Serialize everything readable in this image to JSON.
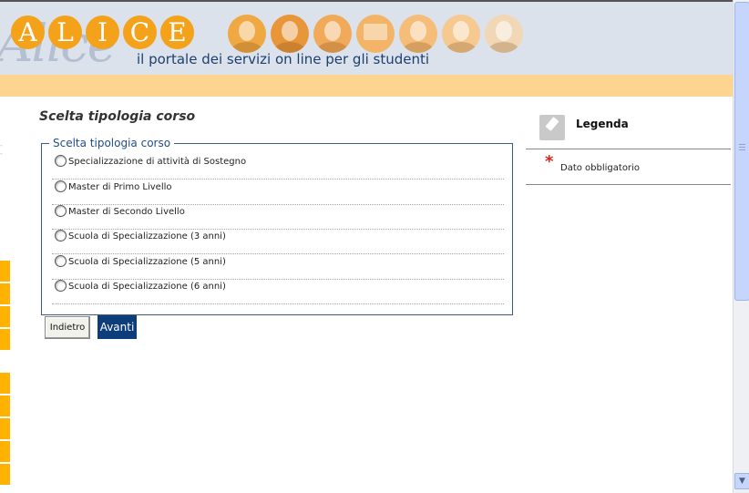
{
  "header": {
    "logo_letters": [
      "A",
      "L",
      "I",
      "C",
      "E"
    ],
    "logo_script": "Alice",
    "tagline": "il portale dei servizi on line per gli studenti"
  },
  "main": {
    "title": "Scelta tipologia corso",
    "fieldset_legend": "Scelta tipologia corso",
    "options": [
      "Specializzazione di attività di Sostegno",
      "Master di Primo Livello",
      "Master di Secondo Livello",
      "Scuola di Specializzazione (3 anni)",
      "Scuola di Specializzazione (5 anni)",
      "Scuola di Specializzazione (6 anni)"
    ],
    "back_button": "Indietro",
    "next_button": "Avanti"
  },
  "legend_panel": {
    "title": "Legenda",
    "required_marker": "*",
    "required_label": "Dato obbligatorio"
  },
  "colors": {
    "logo_orange": "#f3a21a",
    "header_bg": "#dbe2ec",
    "band": "#fdd590",
    "primary_button": "#0e3d7b",
    "required_star": "#d2271f"
  },
  "icons": {
    "scroll_down": "▼"
  }
}
